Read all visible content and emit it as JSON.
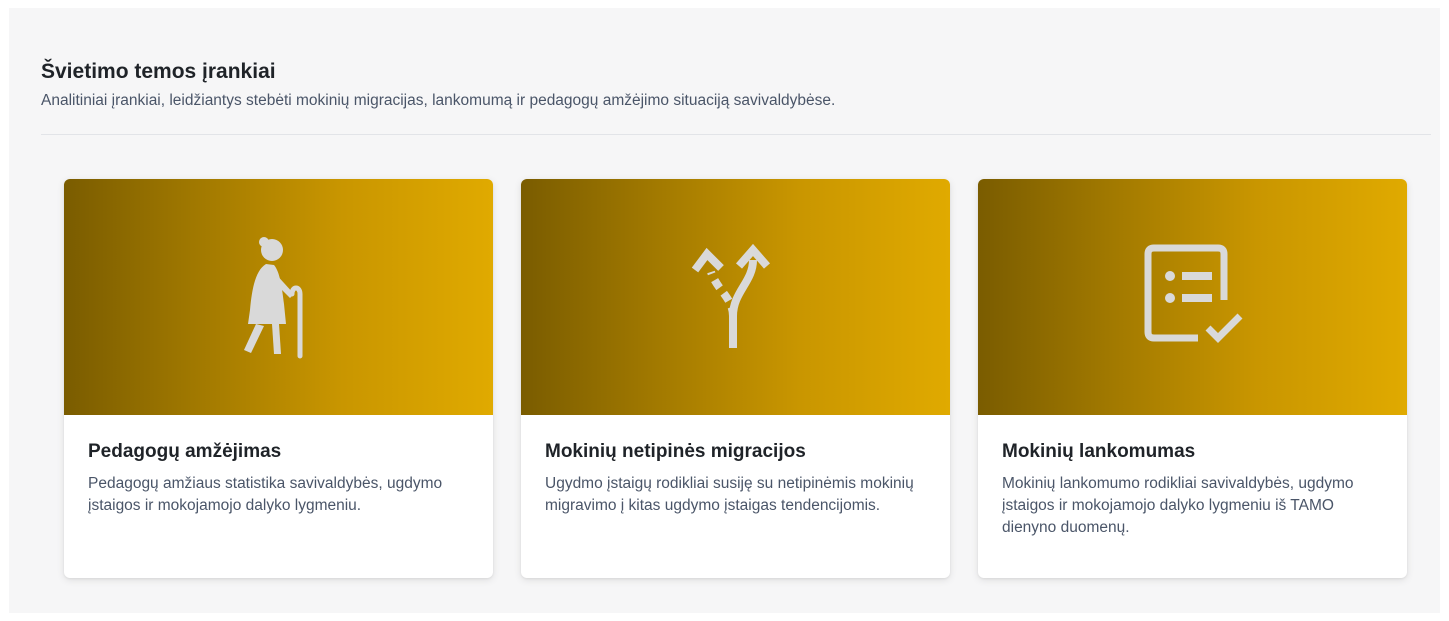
{
  "section": {
    "title": "Švietimo temos įrankiai",
    "subtitle": "Analitiniai įrankiai, leidžiantys stebėti mokinių migracijas, lankomumą ir pedagogų amžėjimo situaciją savivaldybėse."
  },
  "cards": [
    {
      "icon": "elderly-person-icon",
      "title": "Pedagogų amžėjimas",
      "description": "Pedagogų amžiaus statistika savivaldybės, ugdymo įstaigos ir mokojamojo dalyko lygmeniu."
    },
    {
      "icon": "fork-arrows-icon",
      "title": "Mokinių netipinės migracijos",
      "description": "Ugydmo įstaigų rodikliai susiję su netipinėmis mokinių migravimo į kitas ugdymo įstaigas tendencijomis."
    },
    {
      "icon": "checklist-icon",
      "title": "Mokinių lankomumas",
      "description": "Mokinių lankomumo rodikliai savivaldybės, ugdymo įstaigos ir mokojamojo dalyko lygmeniu iš TAMO dienyno duomenų."
    }
  ],
  "colors": {
    "card_gradient_start": "#7a5c00",
    "card_gradient_end": "#e0aa00",
    "icon_color": "#d9d9d9",
    "title_color": "#1f2328",
    "text_color": "#4a5568"
  }
}
